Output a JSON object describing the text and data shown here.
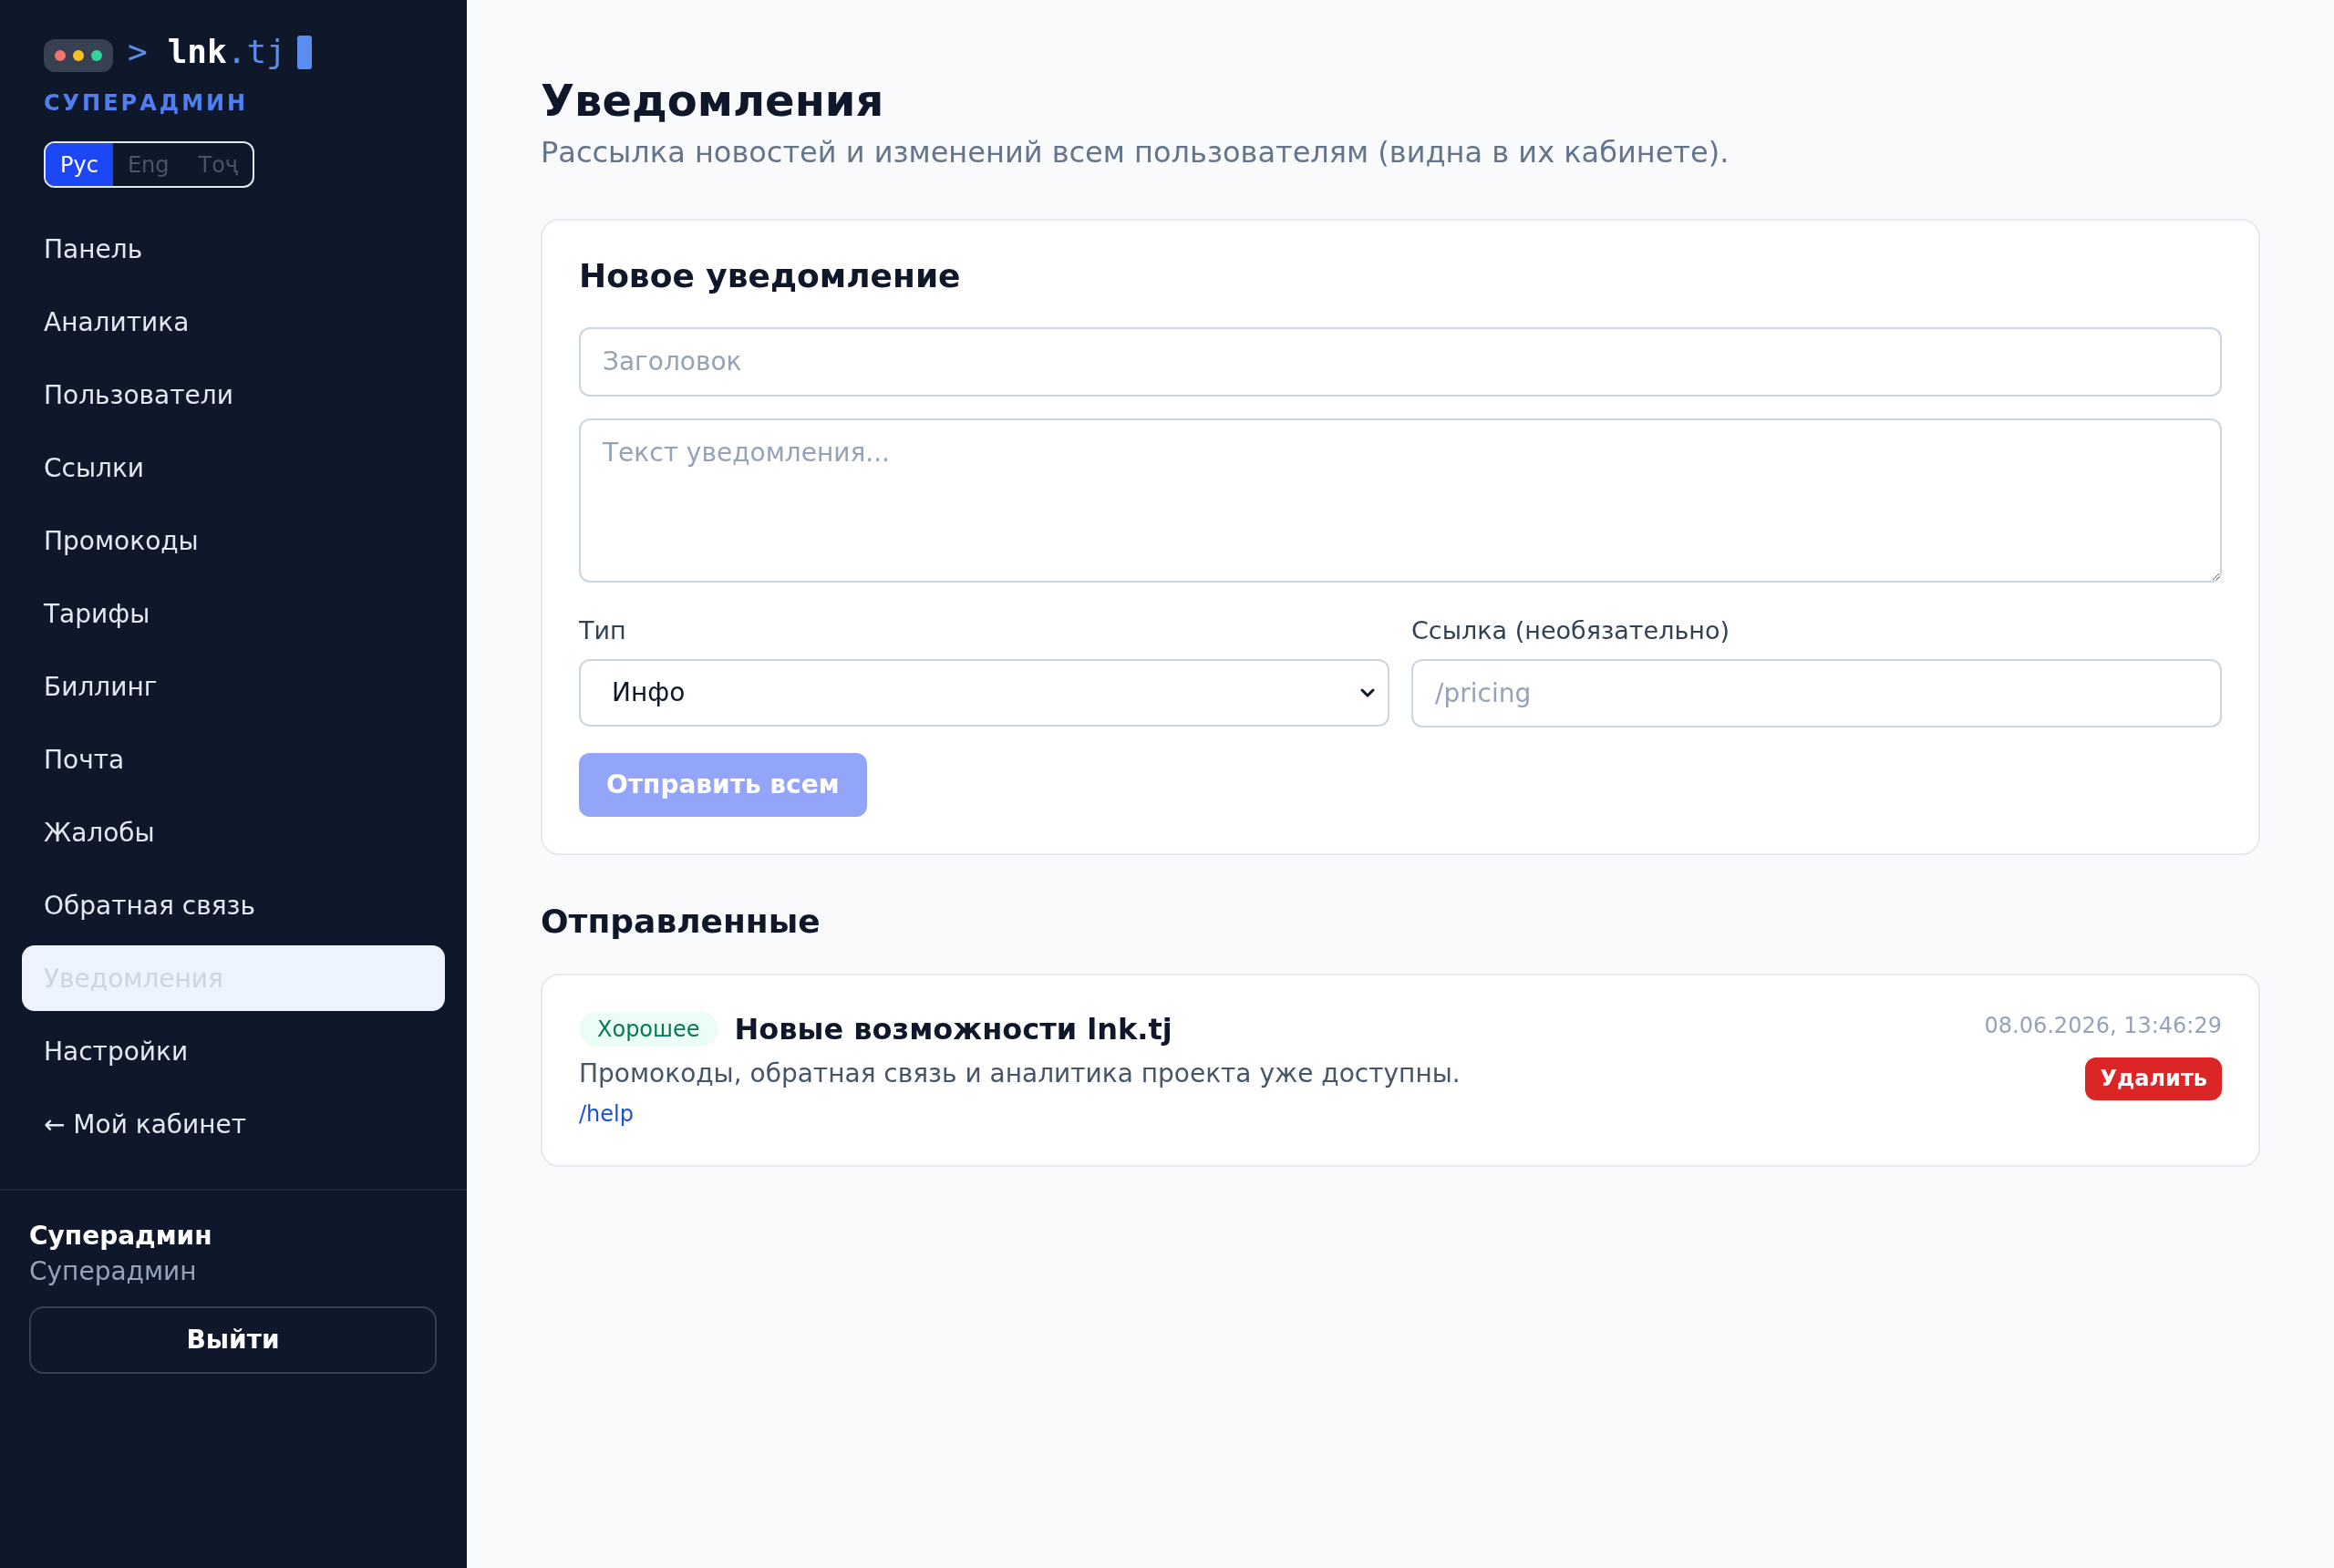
{
  "sidebar": {
    "logo": {
      "prompt": ">",
      "name": "lnk",
      "suffix": ".tj"
    },
    "role": "СУПЕРАДМИН",
    "languages": [
      {
        "label": "Рус",
        "selected": true
      },
      {
        "label": "Eng",
        "selected": false
      },
      {
        "label": "Тоҷ",
        "selected": false
      }
    ],
    "items": [
      {
        "label": "Панель",
        "selected": false
      },
      {
        "label": "Аналитика",
        "selected": false
      },
      {
        "label": "Пользователи",
        "selected": false
      },
      {
        "label": "Ссылки",
        "selected": false
      },
      {
        "label": "Промокоды",
        "selected": false
      },
      {
        "label": "Тарифы",
        "selected": false
      },
      {
        "label": "Биллинг",
        "selected": false
      },
      {
        "label": "Почта",
        "selected": false
      },
      {
        "label": "Жалобы",
        "selected": false
      },
      {
        "label": "Обратная связь",
        "selected": false
      },
      {
        "label": "Уведомления",
        "selected": true
      },
      {
        "label": "Настройки",
        "selected": false
      },
      {
        "label": "← Мой кабинет",
        "selected": false
      }
    ],
    "user": {
      "name": "Суперадмин",
      "role": "Суперадмин"
    },
    "logout_button": "Выйти"
  },
  "page": {
    "title": "Уведомления",
    "subtitle": "Рассылка новостей и изменений всем пользователям (видна в их кабинете)."
  },
  "new_notification": {
    "title": "Новое уведомление",
    "title_field": {
      "placeholder": "Заголовок"
    },
    "text_field": {
      "placeholder": "Текст уведомления..."
    },
    "type_field": {
      "label": "Тип",
      "value": "Инфо"
    },
    "link_field": {
      "label": "Ссылка (необязательно)",
      "placeholder": "/pricing"
    },
    "submit_button": {
      "label": "Отправить всем",
      "disabled": true
    }
  },
  "sent": {
    "title": "Отправленные",
    "items": [
      {
        "type": {
          "label": "Хорошее",
          "kind": "success"
        },
        "title": "Новые возможности lnk.tj",
        "text": "Промокоды, обратная связь и аналитика проекта уже доступны.",
        "link": "/help",
        "date": "08.06.2026, 13:46:29",
        "delete_button": "Удалить"
      }
    ]
  }
}
